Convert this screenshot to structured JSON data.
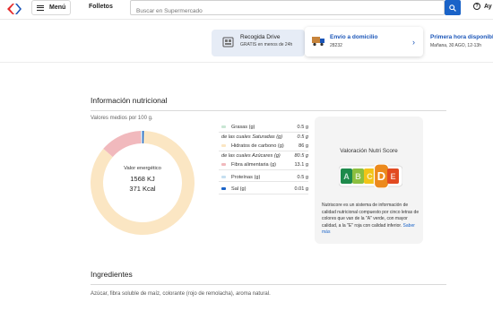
{
  "header": {
    "menu_label": "Menú",
    "folletos": "Folletos",
    "search_placeholder": "Buscar en Supermercado",
    "help_label": "Ay"
  },
  "delivery": {
    "pickup": {
      "title": "Recogida Drive",
      "subtitle": "GRATIS en menos de 24h"
    },
    "home": {
      "title": "Envío a domicilio",
      "subtitle": "28232"
    },
    "slot": {
      "title": "Primera hora disponible",
      "subtitle": "Mañana, 30 AGO, 12-13h"
    }
  },
  "nutrition": {
    "title": "Información nutricional",
    "note": "Valores medios por 100 g.",
    "energy_label": "Valor energético",
    "energy_kj": "1568 KJ",
    "energy_kcal": "371 Kcal",
    "rows": [
      {
        "name": "Grasas (g)",
        "value": "0.5 g",
        "color": "#c9e6d4",
        "sub": false
      },
      {
        "name": "de las cuales Saturadas (g)",
        "value": "0.5 g",
        "sub": true
      },
      {
        "name": "Hidratos de carbono (g)",
        "value": "86 g",
        "color": "#fbe6c3",
        "sub": false
      },
      {
        "name": "de las cuales Azúcares (g)",
        "value": "80.5 g",
        "sub": true
      },
      {
        "name": "Fibra alimentaria (g)",
        "value": "13.1 g",
        "color": "#f1b9bd",
        "sub": false
      },
      {
        "name": "Proteínas (g)",
        "value": "0.5 g",
        "color": "#c6dff0",
        "sub": false
      },
      {
        "name": "Sal (g)",
        "value": "0.01 g",
        "color": "#1a63c8",
        "sub": false
      }
    ],
    "donut_values": [
      0.5,
      86,
      13.1,
      0.5,
      0.01
    ],
    "donut_colors": [
      "#c9e6d4",
      "#fbe6c3",
      "#f1b9bd",
      "#c6dff0",
      "#1a63c8"
    ]
  },
  "nutriscore": {
    "title": "Valoración Nutri Score",
    "letters": [
      "A",
      "B",
      "C",
      "D",
      "E"
    ],
    "letter_colors": [
      "#1d8a4b",
      "#8cbf3f",
      "#f2c418",
      "#ec8a1d",
      "#e24a21"
    ],
    "selected": "D",
    "description": "Nutriscore es un sistema de información de calidad nutricional compuesto por cinco letras de colores que van de la \"A\" verde, con mayor calidad, a la \"E\" roja con calidad inferior.",
    "more_link": "Saber más"
  },
  "ingredients": {
    "title": "Ingredientes",
    "text": "Azúcar, fibra soluble de maíz, colorante (rojo de remolacha), aroma natural."
  }
}
